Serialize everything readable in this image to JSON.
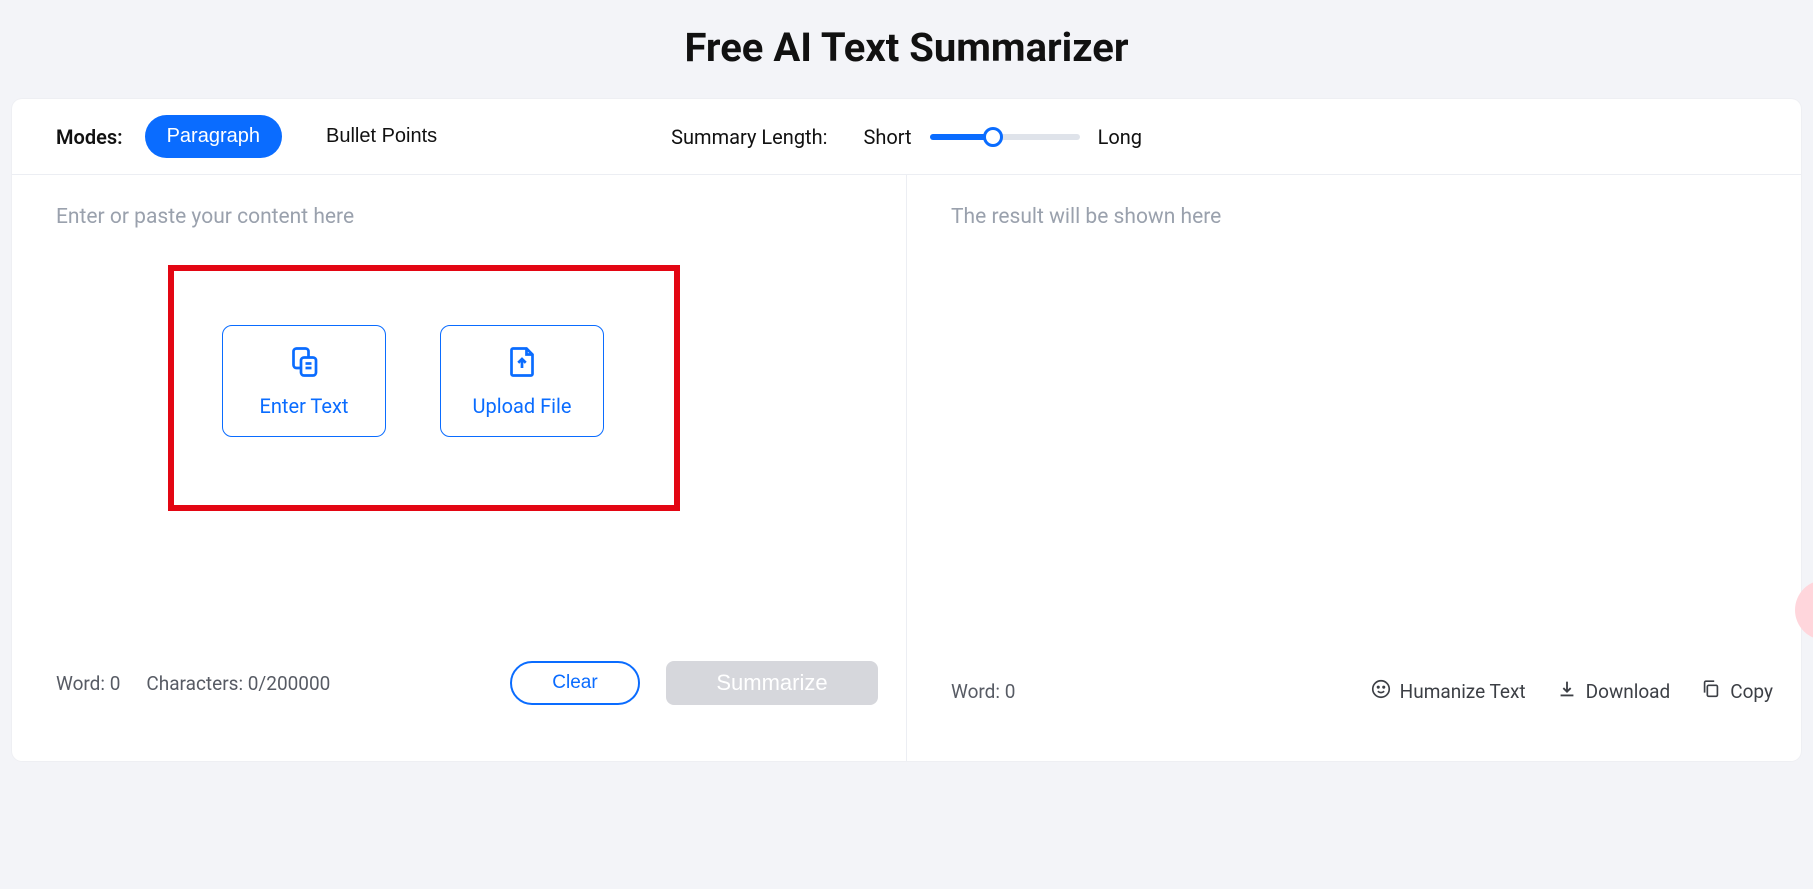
{
  "title": "Free AI Text Summarizer",
  "toolbar": {
    "modes_label": "Modes:",
    "paragraph": "Paragraph",
    "bullet_points": "Bullet Points",
    "length_label": "Summary Length:",
    "short": "Short",
    "long": "Long"
  },
  "input": {
    "placeholder": "Enter or paste your content here",
    "enter_text": "Enter Text",
    "upload_file": "Upload File",
    "word_label": "Word: 0",
    "chars_label": "Characters: 0/200000",
    "clear": "Clear",
    "summarize": "Summarize"
  },
  "output": {
    "placeholder": "The result will be shown here",
    "word_label": "Word: 0",
    "humanize": "Humanize Text",
    "download": "Download",
    "copy": "Copy"
  }
}
